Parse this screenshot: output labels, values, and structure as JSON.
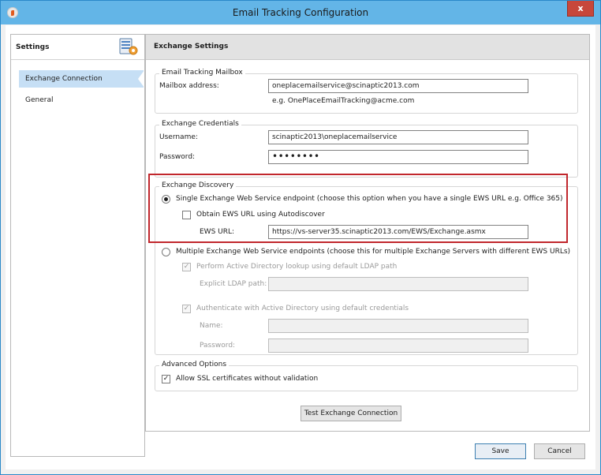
{
  "window": {
    "title": "Email Tracking Configuration",
    "close_glyph": "x"
  },
  "sidebar": {
    "header": "Settings",
    "items": [
      {
        "label": "Exchange Connection",
        "selected": true
      },
      {
        "label": "General",
        "selected": false
      }
    ]
  },
  "main": {
    "header": "Exchange Settings",
    "mailbox": {
      "group_title": "Email Tracking Mailbox",
      "address_label": "Mailbox address:",
      "address_value": "oneplacemailservice@scinaptic2013.com",
      "example": "e.g. OnePlaceEmailTracking@acme.com"
    },
    "credentials": {
      "group_title": "Exchange Credentials",
      "username_label": "Username:",
      "username_value": "scinaptic2013\\oneplacemailservice",
      "password_label": "Password:",
      "password_value": "••••••••"
    },
    "discovery": {
      "group_title": "Exchange Discovery",
      "single_label": "Single Exchange Web Service endpoint (choose this option when you have a single EWS URL e.g. Office 365)",
      "autodiscover_label": "Obtain EWS URL using Autodiscover",
      "ews_url_label": "EWS URL:",
      "ews_url_value": "https://vs-server35.scinaptic2013.com/EWS/Exchange.asmx",
      "multiple_label": "Multiple Exchange Web Service endpoints (choose this for multiple Exchange Servers with different EWS URLs)",
      "ad_lookup_label": "Perform Active Directory lookup using default LDAP path",
      "ldap_label": "Explicit LDAP path:",
      "ldap_value": "",
      "ad_auth_label": "Authenticate with Active Directory using default credentials",
      "name_label": "Name:",
      "name_value": "",
      "password_label": "Password:",
      "password_value": ""
    },
    "advanced": {
      "group_title": "Advanced Options",
      "ssl_label": "Allow SSL certificates without validation"
    },
    "test_button": "Test Exchange Connection"
  },
  "footer": {
    "save_label": "Save",
    "cancel_label": "Cancel"
  },
  "colors": {
    "titlebar": "#63b5e7",
    "close": "#c7473b",
    "selection": "#c6dff5",
    "highlight_box": "#c1272d"
  },
  "icons": {
    "app": "app-logo-icon",
    "settings": "settings-panel-icon",
    "check": "✓"
  }
}
